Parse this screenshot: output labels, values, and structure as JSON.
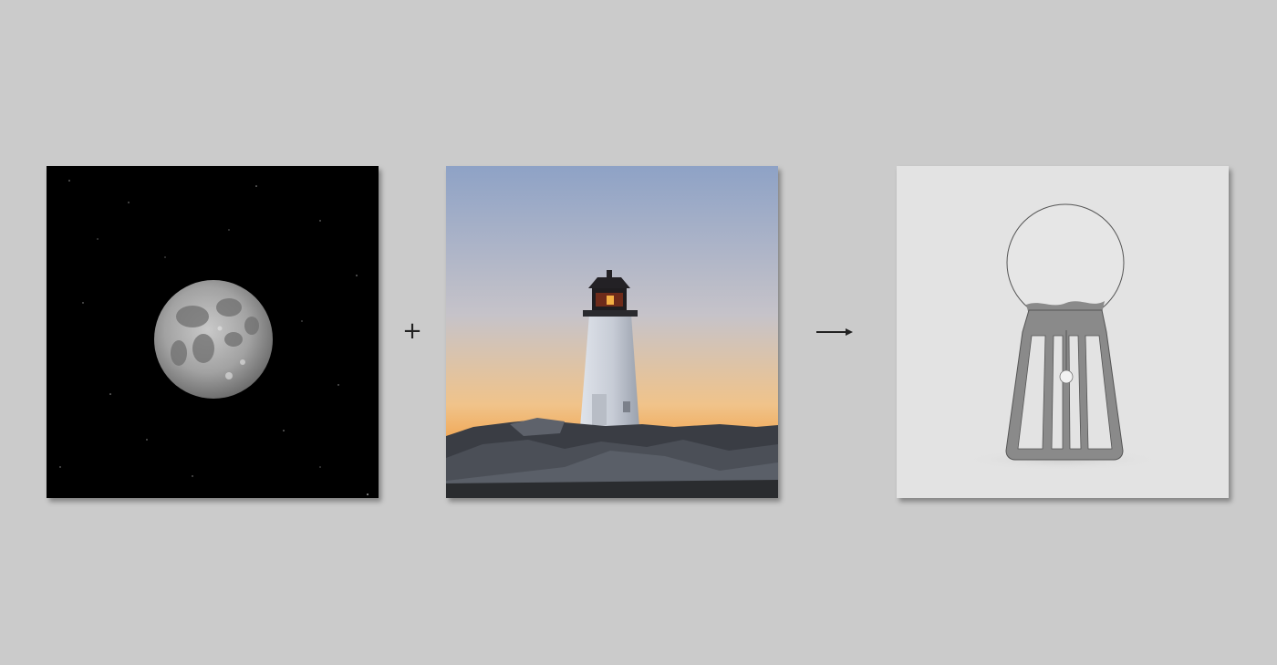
{
  "composition": {
    "operators": {
      "plus": "+",
      "arrow": "right-arrow-icon"
    },
    "panels": [
      {
        "subject": "full-moon-icon",
        "background": "#000000"
      },
      {
        "subject": "lighthouse-icon",
        "sky_top": "#8ea2c6",
        "sky_bottom": "#f2a24a"
      },
      {
        "subject": "lamp-icon",
        "background": "#e3e3e3",
        "accent": "#8a8a8a"
      }
    ]
  }
}
